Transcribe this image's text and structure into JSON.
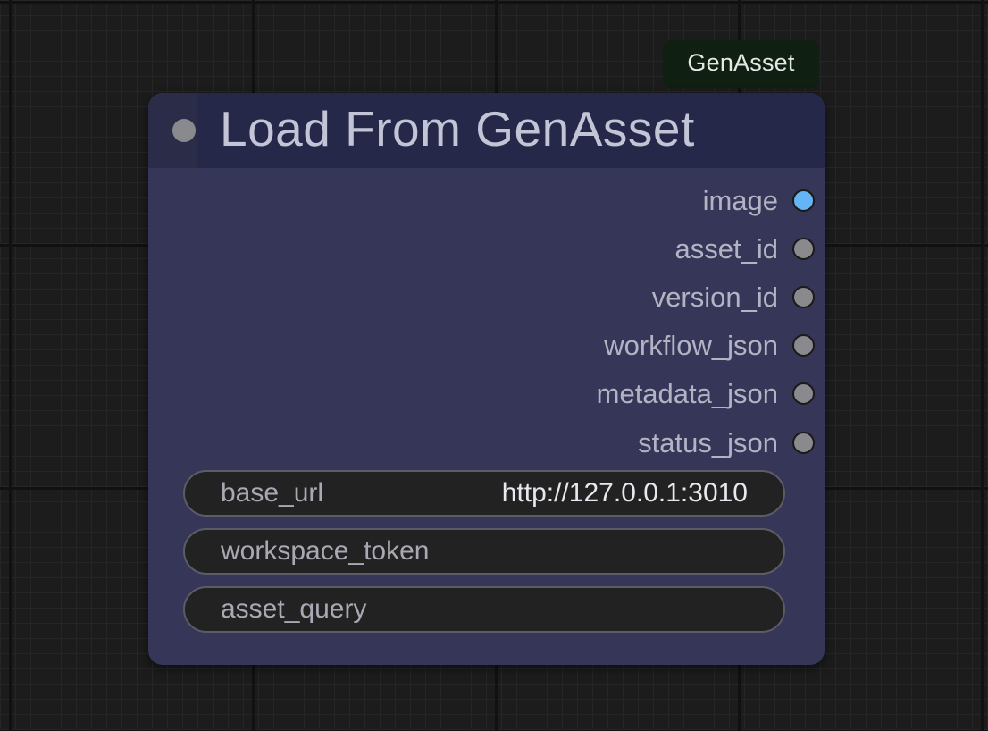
{
  "badge": {
    "label": "GenAsset"
  },
  "node": {
    "title": "Load From GenAsset",
    "outputs": [
      {
        "label": "image",
        "color": "#64b5f6"
      },
      {
        "label": "asset_id",
        "color": "#8a8a8e"
      },
      {
        "label": "version_id",
        "color": "#8a8a8e"
      },
      {
        "label": "workflow_json",
        "color": "#8a8a8e"
      },
      {
        "label": "metadata_json",
        "color": "#8a8a8e"
      },
      {
        "label": "status_json",
        "color": "#8a8a8e"
      }
    ],
    "widgets": [
      {
        "label": "base_url",
        "value": "http://127.0.0.1:3010"
      },
      {
        "label": "workspace_token",
        "value": ""
      },
      {
        "label": "asset_query",
        "value": ""
      }
    ]
  },
  "colors": {
    "canvas_background": "#1c1c1c",
    "node_body": "#363659",
    "node_header": "#26284a",
    "badge_background": "#0f1f12"
  }
}
